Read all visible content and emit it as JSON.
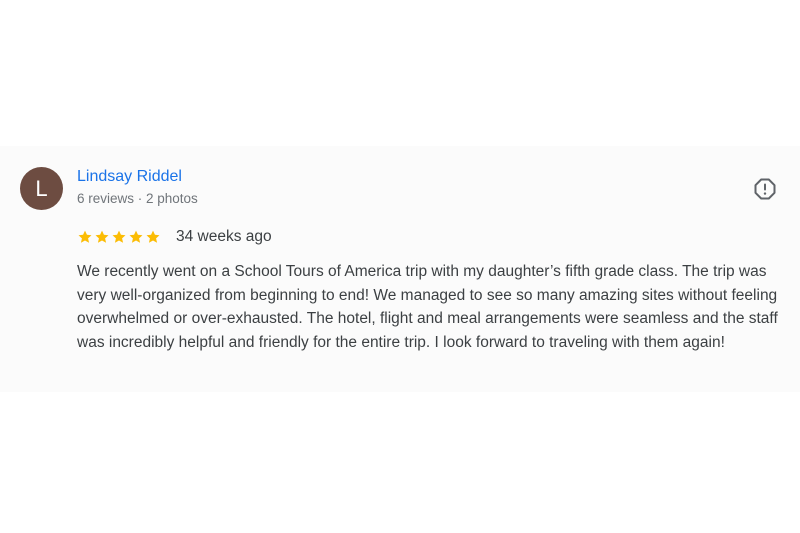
{
  "review": {
    "avatar_letter": "L",
    "avatar_color": "#6d4c41",
    "author": "Lindsay Riddel",
    "meta": "6 reviews · 2 photos",
    "rating": 5,
    "rating_max": 5,
    "star_color": "#fbbc04",
    "time_ago": "34 weeks ago",
    "text": "We recently went on a School Tours of America trip with my daughter’s fifth grade class. The trip was very well-organized from beginning to end! We managed to see so many amazing sites without feeling overwhelmed or over-exhausted. The hotel, flight and meal arrangements were seamless and the staff was incredibly helpful and friendly for the entire trip. I look forward to traveling with them again!",
    "flag_icon": "report-icon"
  }
}
